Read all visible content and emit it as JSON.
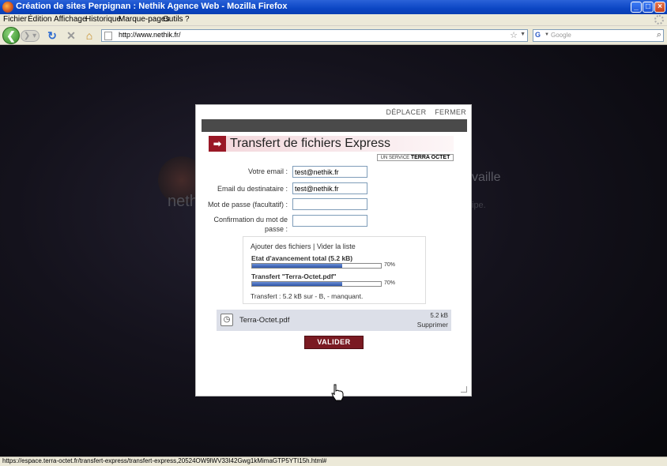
{
  "window": {
    "title": "Création de sites Perpignan : Nethik Agence Web - Mozilla Firefox"
  },
  "menu": {
    "items": [
      "Fichier",
      "Édition",
      "Affichage",
      "Historique",
      "Marque-pages",
      "Outils",
      "?"
    ]
  },
  "toolbar": {
    "url": "http://www.nethik.fr/",
    "search_placeholder": "Google"
  },
  "background": {
    "brand_text": "nethik",
    "side_text": "vaille",
    "side_sub": "ipe."
  },
  "modal": {
    "move_label": "DÉPLACER",
    "close_label": "FERMER",
    "title": "Transfert de fichiers Express",
    "brand_prefix": "UN SERVICE",
    "brand_name": "TERRA OCTET",
    "form": {
      "your_email_label": "Votre email :",
      "your_email_value": "test@nethik.fr",
      "recipient_label": "Email du destinataire :",
      "recipient_value": "test@nethik.fr",
      "password_label": "Mot de passe (facultatif) :",
      "password_value": "",
      "confirm_label": "Confirmation du mot de passe :",
      "confirm_value": ""
    },
    "upload": {
      "links": "Ajouter des fichiers | Vider la liste",
      "total_label": "Etat d'avancement total (5.2 kB)",
      "total_progress": 70,
      "total_pct": "70%",
      "file_label": "Transfert \"Terra-Octet.pdf\"",
      "file_progress": 70,
      "file_pct": "70%",
      "status": "Transfert : 5.2 kB sur - B, - manquant."
    },
    "file": {
      "name": "Terra-Octet.pdf",
      "size": "5.2 kB",
      "remove_label": "Supprimer"
    },
    "submit_label": "VALIDER"
  },
  "statusbar": {
    "text": "https://espace.terra-octet.fr/transfert-express/transfert-express,20524OW9lWV33I42Gwg1kMimaGTP5YTI15h.html#"
  }
}
